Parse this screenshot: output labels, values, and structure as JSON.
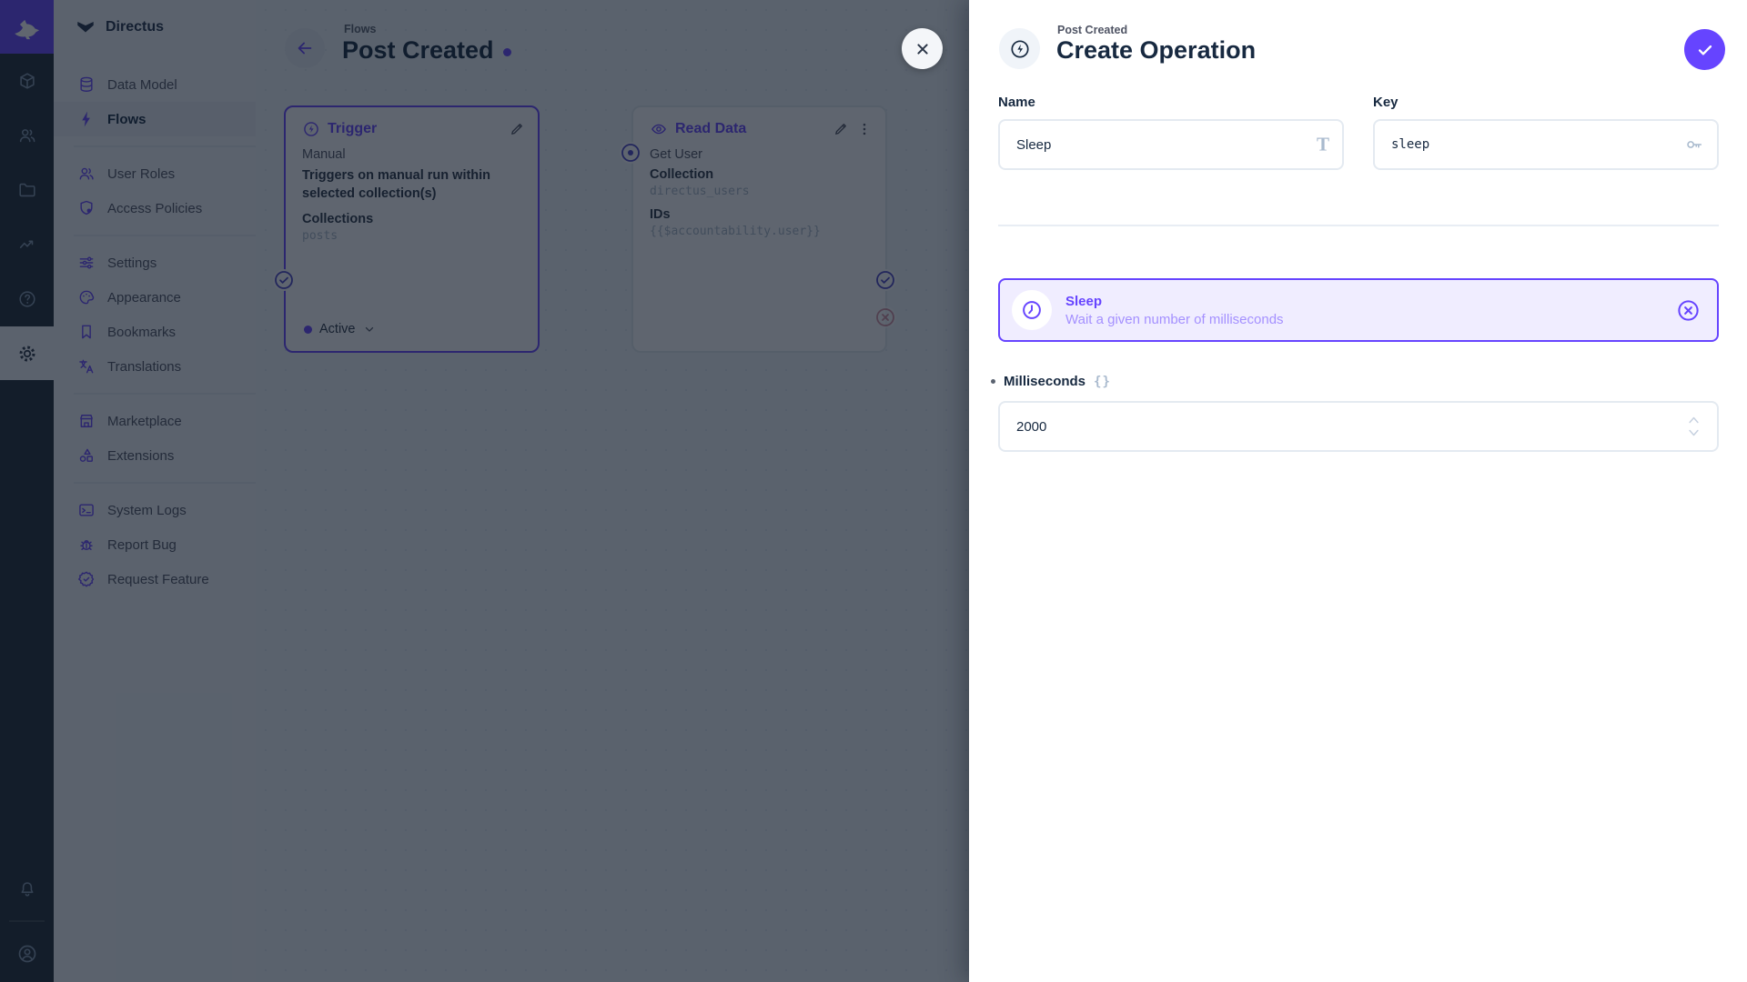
{
  "colors": {
    "accent": "#6644FF",
    "accent_soft": "#F0EDFF",
    "text_dark": "#172940",
    "text_muted": "#4F5464",
    "text_subdued": "#A2B5CD",
    "border": "#E4EAF1",
    "module_bar_bg": "#1E2A36",
    "surface": "#F0F4F9",
    "reject_red": "#C05A74"
  },
  "sidebar": {
    "project_name": "Directus",
    "sections": [
      [
        {
          "label": "Data Model"
        },
        {
          "label": "Flows",
          "active": true
        }
      ],
      [
        {
          "label": "User Roles"
        },
        {
          "label": "Access Policies"
        }
      ],
      [
        {
          "label": "Settings"
        },
        {
          "label": "Appearance"
        },
        {
          "label": "Bookmarks"
        },
        {
          "label": "Translations"
        }
      ],
      [
        {
          "label": "Marketplace"
        },
        {
          "label": "Extensions"
        }
      ],
      [
        {
          "label": "System Logs"
        },
        {
          "label": "Report Bug"
        },
        {
          "label": "Request Feature"
        }
      ]
    ]
  },
  "canvas": {
    "breadcrumb": "Flows",
    "title": "Post Created",
    "trigger": {
      "title": "Trigger",
      "type": "Manual",
      "description": "Triggers on manual run within selected collection(s)",
      "collections_label": "Collections",
      "collections_value": "posts",
      "status": "Active"
    },
    "read_data": {
      "title": "Read Data",
      "name": "Get User",
      "collection_label": "Collection",
      "collection_value": "directus_users",
      "ids_label": "IDs",
      "ids_value": "{{$accountability.user}}"
    }
  },
  "drawer": {
    "breadcrumb": "Post Created",
    "title": "Create Operation",
    "name_field": {
      "label": "Name",
      "value": "Sleep"
    },
    "key_field": {
      "label": "Key",
      "value": "sleep"
    },
    "operation_card": {
      "name": "Sleep",
      "description": "Wait a given number of milliseconds"
    },
    "milliseconds_field": {
      "label": "Milliseconds",
      "value": "2000"
    }
  },
  "icons": {
    "format_title_glyph": "T",
    "raw_value_glyph": "{}"
  }
}
